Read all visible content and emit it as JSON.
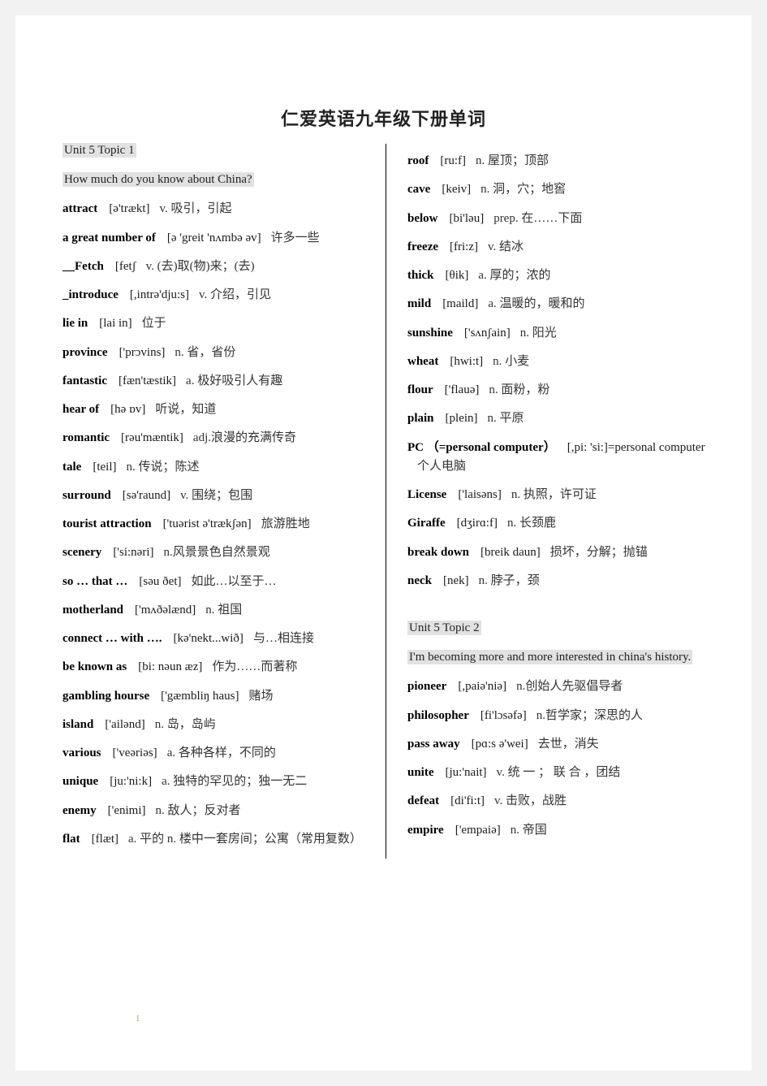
{
  "document": {
    "title": "仁爱英语九年级下册单词",
    "page_number": "1",
    "highlight_color": "#e2e2e2"
  },
  "left_column": {
    "section_title": "Unit 5 Topic 1",
    "section_subtitle": "How much do you know about China?",
    "entries": [
      {
        "word": "attract",
        "phonetic": "[ə'trækt]",
        "definition": "v. 吸引，引起"
      },
      {
        "word": "a great number of",
        "phonetic": "[ə 'greit 'nʌmbə əv]",
        "definition": "许多一些"
      },
      {
        "word": "__Fetch",
        "phonetic": "[fetʃ",
        "definition": "v. (去)取(物)来；(去)"
      },
      {
        "word": "_introduce",
        "phonetic": "[,intrə'dju:s]",
        "definition": "v. 介绍，引见"
      },
      {
        "word": "lie in",
        "phonetic": "[lai in]",
        "definition": "位于"
      },
      {
        "word": "province",
        "phonetic": "['prɔvins]",
        "definition": "n. 省，省份"
      },
      {
        "word": "fantastic",
        "phonetic": "[fæn'tæstik]",
        "definition": "a. 极好吸引人有趣"
      },
      {
        "word": "hear of",
        "phonetic": "[hə ɒv]",
        "definition": "听说，知道"
      },
      {
        "word": "romantic",
        "phonetic": "[rəu'mæntik]",
        "definition": "adj.浪漫的充满传奇"
      },
      {
        "word": "tale",
        "phonetic": "[teil]",
        "definition": "n. 传说；陈述"
      },
      {
        "word": "surround",
        "phonetic": "[sə'raund]",
        "definition": "v. 围绕；包围"
      },
      {
        "word": "tourist attraction",
        "phonetic": "['tuərist ə'trækʃən]",
        "definition": "旅游胜地"
      },
      {
        "word": "scenery",
        "phonetic": "['si:nəri]",
        "definition": "n.风景景色自然景观"
      },
      {
        "word": "so … that …",
        "phonetic": "[səu ðet]",
        "definition": "如此…以至于…"
      },
      {
        "word": "motherland",
        "phonetic": "['mʌðəlænd]",
        "definition": "n. 祖国"
      },
      {
        "word": "connect … with ….",
        "phonetic": "[kə'nekt...wið]",
        "definition": "与…相连接"
      },
      {
        "word": "be known as",
        "phonetic": "[bi: nəun æz]",
        "definition": "作为……而著称"
      },
      {
        "word": "gambling hourse",
        "phonetic": "['gæmbliŋ haus]",
        "definition": "赌场"
      },
      {
        "word": "island",
        "phonetic": "['ailənd]",
        "definition": "n. 岛，岛屿"
      },
      {
        "word": "various",
        "phonetic": "['veəriəs]",
        "definition": "a. 各种各样，不同的"
      },
      {
        "word": "unique",
        "phonetic": "[ju:'ni:k]",
        "definition": "a. 独特的罕见的；独一无二"
      },
      {
        "word": "enemy",
        "phonetic": "['enimi]",
        "definition": "n. 敌人；反对者"
      },
      {
        "word": "flat",
        "phonetic": "[flæt]",
        "definition": "a. 平的 n. 楼中一套房间；公寓（常用复数）"
      }
    ]
  },
  "right_column": {
    "topic1_entries": [
      {
        "word": "roof",
        "phonetic": "[ru:f]",
        "definition": "n. 屋顶；顶部"
      },
      {
        "word": "cave",
        "phonetic": "[keiv]",
        "definition": "n. 洞，穴；地窖"
      },
      {
        "word": "below",
        "phonetic": "[bi'ləu]",
        "definition": "prep. 在……下面"
      },
      {
        "word": "freeze",
        "phonetic": "[fri:z]",
        "definition": "v. 结冰"
      },
      {
        "word": "thick",
        "phonetic": "[θik]",
        "definition": "a. 厚的；浓的"
      },
      {
        "word": "mild",
        "phonetic": "[maild]",
        "definition": "a. 温暖的，暖和的"
      },
      {
        "word": "sunshine",
        "phonetic": "['sʌnʃain]",
        "definition": "n. 阳光"
      },
      {
        "word": "wheat",
        "phonetic": "[hwi:t]",
        "definition": "n. 小麦"
      },
      {
        "word": "flour",
        "phonetic": "['flauə]",
        "definition": "n. 面粉，粉"
      },
      {
        "word": "plain",
        "phonetic": "[plein]",
        "definition": "n. 平原"
      },
      {
        "word": "PC （=personal computer）",
        "phonetic": "[,pi: 'si:]=personal computer",
        "definition": "个人电脑"
      },
      {
        "word": "License",
        "phonetic": "['laisəns]",
        "definition": "n. 执照，许可证"
      },
      {
        "word": "Giraffe",
        "phonetic": "[dʒirɑ:f]",
        "definition": "n. 长颈鹿"
      },
      {
        "word": "break down",
        "phonetic": "[breik daun]",
        "definition": "损坏，分解；抛锚"
      },
      {
        "word": "neck",
        "phonetic": "[nek]",
        "definition": "n. 脖子，颈"
      }
    ],
    "section_title": "Unit 5 Topic 2",
    "section_subtitle": "I'm becoming more and more interested in china's history.",
    "topic2_entries": [
      {
        "word": "pioneer",
        "phonetic": "[,paiə'niə]",
        "definition": "n.创始人先驱倡导者"
      },
      {
        "word": "philosopher",
        "phonetic": "[fi'lɔsəfə]",
        "definition": "n.哲学家；深思的人"
      },
      {
        "word": "pass away",
        "phonetic": "[pɑ:s ə'wei]",
        "definition": "去世，消失"
      },
      {
        "word": "unite",
        "phonetic": "[ju:'nait]",
        "definition": "v. 统 一 ； 联 合 ，团结"
      },
      {
        "word": "defeat",
        "phonetic": "[di'fi:t]",
        "definition": "v. 击败，战胜"
      },
      {
        "word": "empire",
        "phonetic": "['empaiə]",
        "definition": "n. 帝国"
      }
    ]
  }
}
